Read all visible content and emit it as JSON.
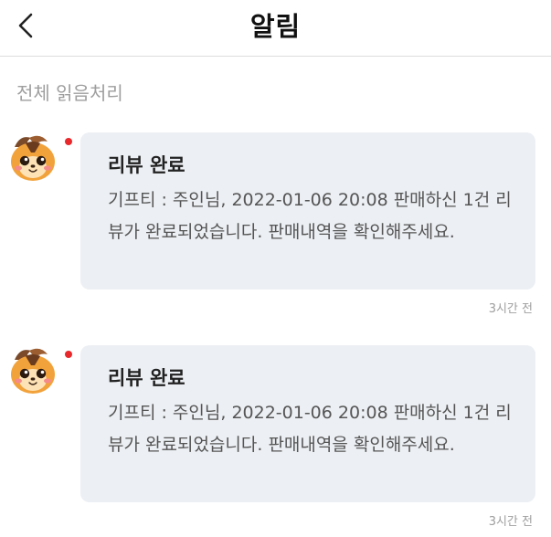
{
  "header": {
    "title": "알림",
    "back_icon": "chevron-left-icon"
  },
  "read_all_label": "전체 읽음처리",
  "notifications": [
    {
      "title": "리뷰 완료",
      "body": "기프티 : 주인님, 2022-01-06 20:08 판매하신 1건 리뷰가 완료되었습니다. 판매내역을 확인해주세요.",
      "time": "3시간 전",
      "unread": true,
      "avatar_icon": "squirrel-mascot-icon"
    },
    {
      "title": "리뷰 완료",
      "body": "기프티 : 주인님, 2022-01-06 20:08 판매하신 1건 리뷰가 완료되었습니다. 판매내역을 확인해주세요.",
      "time": "3시간 전",
      "unread": true,
      "avatar_icon": "squirrel-mascot-icon"
    }
  ],
  "colors": {
    "unread_dot": "#e8282b",
    "bubble_bg": "#eceff3",
    "muted_text": "#9e9e9e"
  }
}
